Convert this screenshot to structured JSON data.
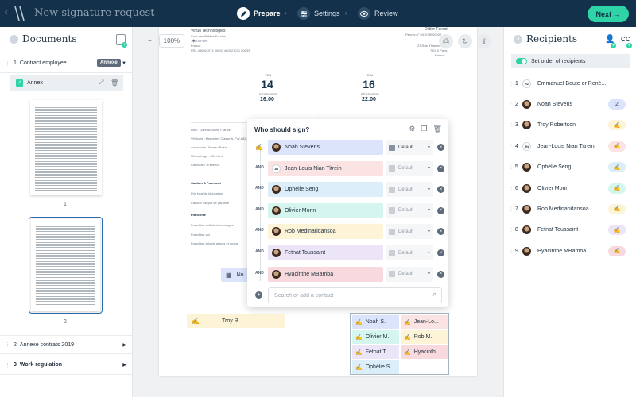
{
  "header": {
    "title": "New signature request",
    "steps": [
      {
        "label": "Prepare",
        "active": true
      },
      {
        "label": "Settings",
        "active": false
      },
      {
        "label": "Review",
        "active": false
      }
    ],
    "next_label": "Next →"
  },
  "documents": {
    "step_number": "1",
    "title": "Documents",
    "items": [
      {
        "number": "1",
        "label": "Contract employee",
        "tag": "Annexe"
      },
      {
        "number": "2",
        "label": "Annexe contrats 2019"
      },
      {
        "number": "3",
        "label": "Work regulation"
      }
    ],
    "annex_label": "Annex",
    "pages": [
      "1",
      "2"
    ]
  },
  "canvas": {
    "zoom": "100%",
    "zoom_minus": "−",
    "zoom_plus": "+",
    "page_texts": {
      "company": "Virtuo Technologies",
      "addr1": "Cour des Petites Ecuries",
      "addr2": "75010 Paris",
      "addr3": "France",
      "addr4": "FR4 480021071 00033 480021071 00033",
      "client": "Didier Forest",
      "client_sub": "Permis n° 041078900002",
      "client_addr1": "23 Rue d'Hauteville",
      "client_addr2": "75010 Paris",
      "client_addr3": "France",
      "start_label": "VEN",
      "start_day": "14",
      "start_month": "DÉCEMBRE",
      "start_time": "16:00",
      "end_label": "DIM",
      "end_day": "16",
      "end_month": "DÉCEMBRE",
      "end_time": "22:00",
      "info1": "Lieu : Gare du Nord, France",
      "info2": "Véhicule : Mercedes Classe A, FW-682-EJ",
      "info3": "Assurance : Niveau Basic",
      "info4": "Kilométrage : 400 Kms",
      "info5": "Carburant : Essence",
      "caution_title": "Caution & Paiement",
      "caution1": "Prix total de la location",
      "caution2": "Caution / dépôt de garantie",
      "franchise_title": "Franchise",
      "fr1": "Franchise collision/dommages",
      "fr2": "Franchise vol",
      "fr3": "Franchise bris de glaces et pneus"
    },
    "date_field_label": "No",
    "troy_field": "Troy R.",
    "field_grid": [
      {
        "name": "Noah S.",
        "color": "#dbe4fb"
      },
      {
        "name": "Jean-Lo...",
        "color": "#fbe3e3"
      },
      {
        "name": "Olivier M.",
        "color": "#d5f5ef"
      },
      {
        "name": "Rob M.",
        "color": "#fdf3d6"
      },
      {
        "name": "Fetnat T.",
        "color": "#ece4f7"
      },
      {
        "name": "Hyacinth...",
        "color": "#f8d9dd"
      },
      {
        "name": "Ophélie S.",
        "color": "#dbeef9"
      }
    ]
  },
  "popup": {
    "title": "Who should sign?",
    "signers": [
      {
        "connector": "",
        "name": "Noah Stevens",
        "color": "#dbe4fb",
        "select": "Default",
        "on": true,
        "initials": ""
      },
      {
        "connector": "AND",
        "name": "Jean-Louis Nian Titrein",
        "color": "#fbe3e3",
        "select": "Default",
        "on": false,
        "initials": "JN"
      },
      {
        "connector": "AND",
        "name": "Ophélie Seng",
        "color": "#dbeef9",
        "select": "Default",
        "on": false,
        "initials": ""
      },
      {
        "connector": "AND",
        "name": "Olivier Morin",
        "color": "#d5f5ef",
        "select": "Default",
        "on": false,
        "initials": ""
      },
      {
        "connector": "AND",
        "name": "Rob Medinaridansoa",
        "color": "#fdf3d6",
        "select": "Default",
        "on": false,
        "initials": ""
      },
      {
        "connector": "AND",
        "name": "Fetnat Toussaint",
        "color": "#ece4f7",
        "select": "Default",
        "on": false,
        "initials": ""
      },
      {
        "connector": "AND",
        "name": "Hyacinthe MBamba",
        "color": "#f8d9dd",
        "select": "Default",
        "on": false,
        "initials": ""
      }
    ],
    "search_placeholder": "Search or add a contact"
  },
  "recipients": {
    "step_number": "3",
    "title": "Recipients",
    "cc_label": "CC",
    "order_label": "Set order of recipients",
    "items": [
      {
        "index": "1",
        "initials": "RZ",
        "name": "Emmanuel Boute or René...",
        "pill": "",
        "color": ""
      },
      {
        "index": "2",
        "initials": "",
        "name": "Noah Stevens",
        "pill": "2",
        "color": "#dbe4fb"
      },
      {
        "index": "3",
        "initials": "",
        "name": "Troy Robertson",
        "pill": "",
        "color": "#fdf3d6"
      },
      {
        "index": "4",
        "initials": "JN",
        "name": "Jean-Louis Nian Titrein",
        "pill": "",
        "color": "#fbe3e3"
      },
      {
        "index": "5",
        "initials": "",
        "name": "Ophélie Seng",
        "pill": "",
        "color": "#dbeef9"
      },
      {
        "index": "6",
        "initials": "",
        "name": "Olivier Morin",
        "pill": "",
        "color": "#d5f5ef"
      },
      {
        "index": "7",
        "initials": "",
        "name": "Rob Medinaridansoa",
        "pill": "",
        "color": "#fdf3d6"
      },
      {
        "index": "8",
        "initials": "",
        "name": "Fetnat Toussaint",
        "pill": "",
        "color": "#ece4f7"
      },
      {
        "index": "9",
        "initials": "",
        "name": "Hyacinthe MBamba",
        "pill": "",
        "color": "#f8d9dd"
      }
    ]
  },
  "colors": {
    "header_bg": "#13314a",
    "accent": "#2ed3a6"
  }
}
